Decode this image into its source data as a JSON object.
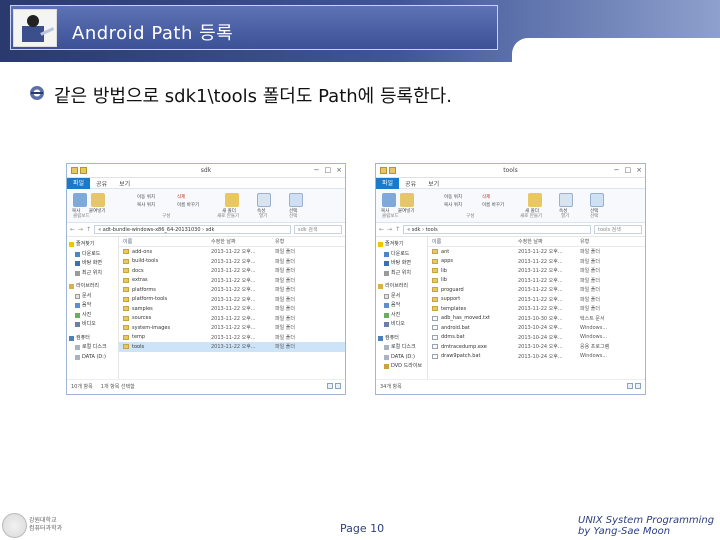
{
  "slide": {
    "title": "Android Path 등록",
    "bullet": "같은 방법으로 sdk1\\tools 폴더도 Path에 등록한다.",
    "page": "Page 10",
    "credit_line1": "UNIX System Programming",
    "credit_line2": "by Yang-Sae Moon",
    "institution_line1": "강원대학교",
    "institution_line2": "컴퓨터과학과"
  },
  "explorer_common": {
    "menu": [
      "파일",
      "공유",
      "보기"
    ],
    "ribbon_groups": [
      "클립보드",
      "구성",
      "새로 만들기",
      "열기",
      "선택"
    ],
    "ribbon_items": [
      "복사",
      "붙여넣기",
      "이동 위치",
      "복사 위치",
      "삭제",
      "이름 바꾸기",
      "새 폴더",
      "속성",
      "선택"
    ],
    "columns": [
      "이름",
      "수정한 날짜",
      "유형"
    ],
    "nav": {
      "favorites": "즐겨찾기",
      "download": "다운로드",
      "desktop": "바탕 화면",
      "recent": "최근 위치",
      "libraries": "라이브러리",
      "docs": "문서",
      "music": "음악",
      "pictures": "사진",
      "videos": "비디오",
      "computer": "컴퓨터",
      "local_disk": "로컬 디스크",
      "data": "DATA (D:)",
      "dvd": "DVD 드라이브"
    }
  },
  "window_left": {
    "title": "sdk",
    "path": "« adt-bundle-windows-x86_64-20131030 › sdk",
    "search": "sdk 검색",
    "status_count": "10개 항목",
    "status_selected": "1개 항목 선택함",
    "files": [
      {
        "name": "add-ons",
        "date": "2013-11-22 오후...",
        "type": "파일 폴더"
      },
      {
        "name": "build-tools",
        "date": "2013-11-22 오후...",
        "type": "파일 폴더"
      },
      {
        "name": "docs",
        "date": "2013-11-22 오후...",
        "type": "파일 폴더"
      },
      {
        "name": "extras",
        "date": "2013-11-22 오후...",
        "type": "파일 폴더"
      },
      {
        "name": "platforms",
        "date": "2013-11-22 오후...",
        "type": "파일 폴더"
      },
      {
        "name": "platform-tools",
        "date": "2013-11-22 오후...",
        "type": "파일 폴더"
      },
      {
        "name": "samples",
        "date": "2013-11-22 오후...",
        "type": "파일 폴더"
      },
      {
        "name": "sources",
        "date": "2013-11-22 오후...",
        "type": "파일 폴더"
      },
      {
        "name": "system-images",
        "date": "2013-11-22 오후...",
        "type": "파일 폴더"
      },
      {
        "name": "temp",
        "date": "2013-11-22 오후...",
        "type": "파일 폴더"
      },
      {
        "name": "tools",
        "date": "2013-11-22 오후...",
        "type": "파일 폴더"
      }
    ]
  },
  "window_right": {
    "title": "tools",
    "path": "« sdk › tools",
    "search": "tools 검색",
    "status_count": "34개 항목",
    "files": [
      {
        "name": "ant",
        "date": "2013-11-22 오후...",
        "type": "파일 폴더"
      },
      {
        "name": "apps",
        "date": "2013-11-22 오후...",
        "type": "파일 폴더"
      },
      {
        "name": "lib",
        "date": "2013-11-22 오후...",
        "type": "파일 폴더"
      },
      {
        "name": "lib",
        "date": "2013-11-22 오후...",
        "type": "파일 폴더"
      },
      {
        "name": "proguard",
        "date": "2013-11-22 오후...",
        "type": "파일 폴더"
      },
      {
        "name": "support",
        "date": "2013-11-22 오후...",
        "type": "파일 폴더"
      },
      {
        "name": "templates",
        "date": "2013-11-22 오후...",
        "type": "파일 폴더"
      },
      {
        "name": "adb_has_moved.txt",
        "date": "2013-10-30 오후...",
        "type": "텍스트 문서"
      },
      {
        "name": "android.bat",
        "date": "2013-10-24 오후...",
        "type": "Windows..."
      },
      {
        "name": "ddms.bat",
        "date": "2013-10-24 오후...",
        "type": "Windows..."
      },
      {
        "name": "dmtracedump.exe",
        "date": "2013-10-24 오후...",
        "type": "응용 프로그램"
      },
      {
        "name": "draw9patch.bat",
        "date": "2013-10-24 오후...",
        "type": "Windows..."
      }
    ]
  }
}
